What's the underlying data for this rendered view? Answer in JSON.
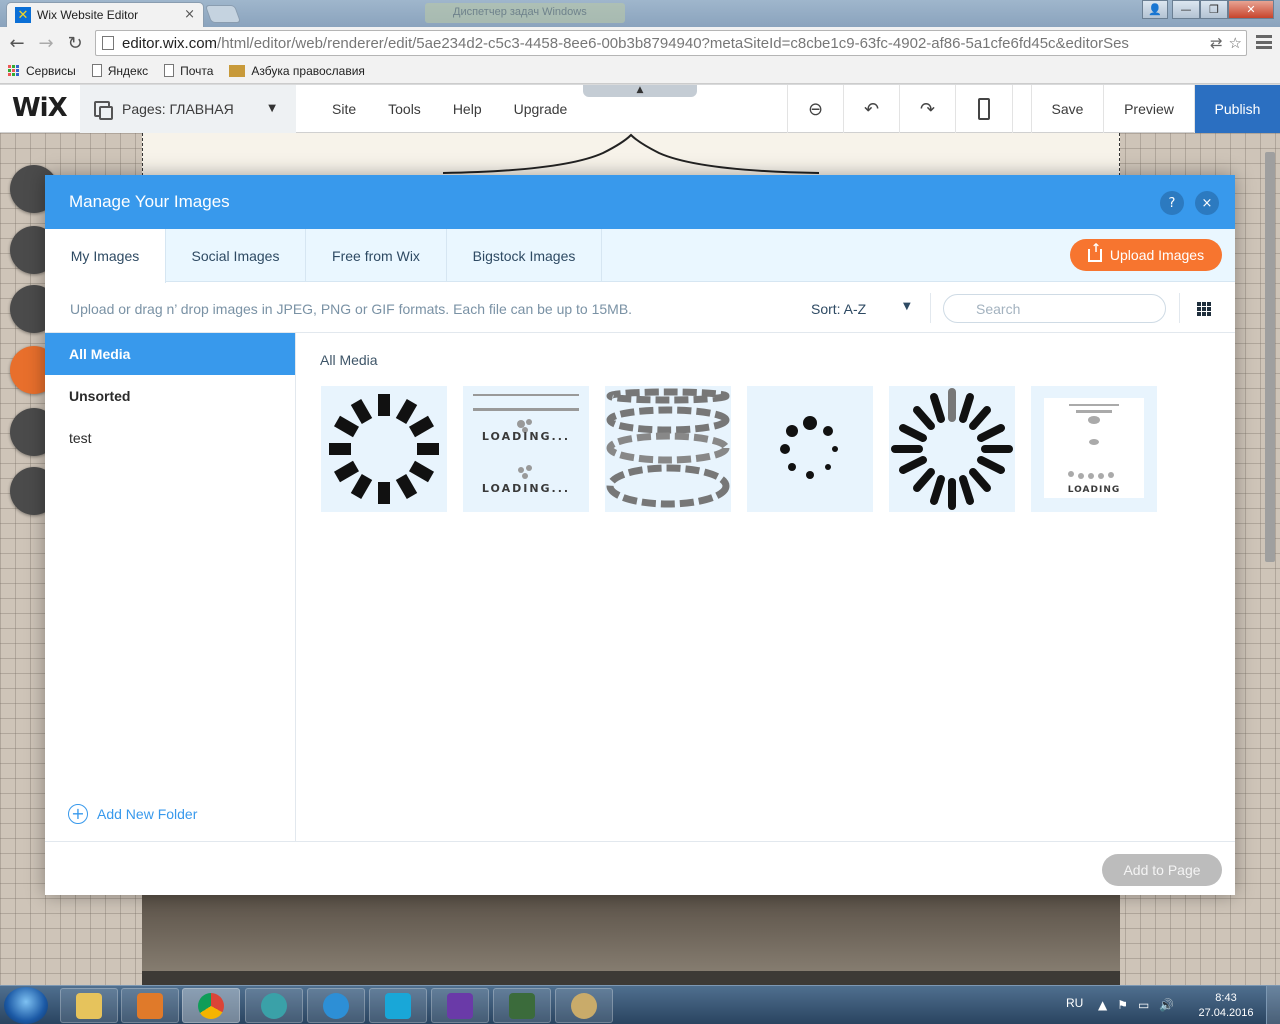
{
  "browser": {
    "tab_title": "Wix Website Editor",
    "tab_close": "×",
    "background_window_title": "Диспетчер задач Windows",
    "address_host": "editor.wix.com",
    "address_path": "/html/editor/web/renderer/edit/5ae234d2-c5c3-4458-8ee6-00b3b8794940?metaSiteId=c8cbe1c9-63fc-4902-af86-5a1cfe6fd45c&editorSes",
    "bookmarks": [
      "Сервисы",
      "Яндекс",
      "Почта",
      "Азбука православия"
    ]
  },
  "wix": {
    "logo": "WiX",
    "pages_label": "Pages: ГЛАВНАЯ",
    "menu": [
      "Site",
      "Tools",
      "Help",
      "Upgrade"
    ],
    "save": "Save",
    "preview": "Preview",
    "publish": "Publish"
  },
  "modal": {
    "title": "Manage Your Images",
    "help": "?",
    "close": "×",
    "tabs": [
      "My Images",
      "Social Images",
      "Free from Wix",
      "Bigstock Images"
    ],
    "upload_button": "Upload Images",
    "info": "Upload or drag n’ drop images in JPEG, PNG or GIF formats. Each file can be up to 15MB.",
    "sort_label": "Sort: A-Z",
    "search_placeholder": "Search",
    "folders": [
      "All Media",
      "Unsorted",
      "test"
    ],
    "add_folder": "Add New Folder",
    "media_title": "All Media",
    "thumb_loading_text": [
      "LOADING...",
      "LOADING...",
      "LOADING"
    ],
    "add_to_page": "Add to Page"
  },
  "taskbar": {
    "lang": "RU",
    "time": "8:43",
    "date": "27.04.2016"
  },
  "colors": {
    "accent": "#3899ec",
    "upload": "#f7752f",
    "publish": "#2b6fc1"
  }
}
